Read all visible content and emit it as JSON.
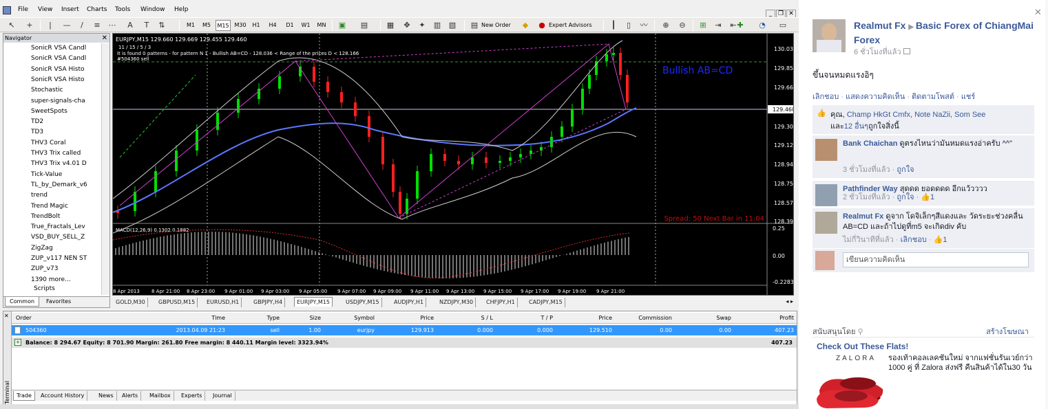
{
  "menubar": {
    "items": [
      "File",
      "View",
      "Insert",
      "Charts",
      "Tools",
      "Window",
      "Help"
    ]
  },
  "toolbar": {
    "periods": [
      "M1",
      "M5",
      "M15",
      "M30",
      "H1",
      "H4",
      "D1",
      "W1",
      "MN"
    ],
    "new_order": "New Order",
    "expert_advisors": "Expert Advisors"
  },
  "navigator": {
    "title": "Navigator",
    "items": [
      "SonicR VSA Candl",
      "SonicR VSA Candl",
      "SonicR VSA Histo",
      "SonicR VSA Histo",
      "Stochastic",
      "super-signals-cha",
      "SweetSpots",
      "TD2",
      "TD3",
      "THV3 Coral",
      "THV3 Trix called",
      "THV3 Trix v4.01 D",
      "Tick-Value",
      "TL_by_Demark_v6",
      "trend",
      "Trend Magic",
      "TrendBolt",
      "True_Fractals_Lev",
      "VSD_BUY_SELL_Z",
      "ZigZag",
      "ZUP_v117 NEN ST",
      "ZUP_v73",
      "1390 more..."
    ],
    "scripts": "Scripts",
    "tabs": [
      "Common",
      "Favorites"
    ]
  },
  "chart": {
    "header": "EURJPY,M15  129.660 129.669 129.455 129.460",
    "line2": "11 / 15 / 5 / 3",
    "line3": "It is found 0 patterns  -  for pattern N 1 - Bullish AB=CD - 128.036 < Range of the prices D < 128.166",
    "line4": "#504360 sell",
    "pattern_label": "Bullish AB=CD",
    "spread_text": "Spread: 50  Next Bar in 11:04",
    "price_labels": [
      "130.030",
      "129.850",
      "129.665",
      "129.460",
      "129.305",
      "129.120",
      "128.940",
      "128.755",
      "128.575",
      "128.395"
    ],
    "current_price": "129.460",
    "macd_label": "MACD(12,26,9) 0.1302 0.1882",
    "macd_levels": [
      "0.25",
      "0.00",
      "-0.2283"
    ],
    "time_labels": [
      "8 Apr 2013",
      "8 Apr 21:00",
      "8 Apr 23:00",
      "9 Apr 01:00",
      "9 Apr 03:00",
      "9 Apr 05:00",
      "9 Apr 07:00",
      "9 Apr 09:00",
      "9 Apr 11:00",
      "9 Apr 13:00",
      "9 Apr 15:00",
      "9 Apr 17:00",
      "9 Apr 19:00",
      "9 Apr 21:00"
    ]
  },
  "chart_tabs": [
    "GOLD,M30",
    "GBPUSD,M15",
    "EURUSD,H1",
    "GBPJPY,H4",
    "EURJPY,M15",
    "USDJPY,M15",
    "AUDJPY,H1",
    "NZDJPY,M30",
    "CHFJPY,H1",
    "CADJPY,M15"
  ],
  "terminal": {
    "side_label": "Terminal",
    "headers": [
      "Order",
      "Time",
      "Type",
      "Size",
      "Symbol",
      "Price",
      "S / L",
      "T / P",
      "Price",
      "Commission",
      "Swap",
      "Profit"
    ],
    "order_row": [
      "504360",
      "2013.04.09 21:23",
      "sell",
      "1.00",
      "eurjpy",
      "129.913",
      "0.000",
      "0.000",
      "129.510",
      "0.00",
      "0.00",
      "407.23"
    ],
    "balance_row": "Balance: 8 294.67  Equity: 8 701.90  Margin: 261.80  Free margin: 8 440.11  Margin level: 3323.94%",
    "balance_profit": "407.23",
    "tabs": [
      "Trade",
      "Account History",
      "News",
      "Alerts",
      "Mailbox",
      "Experts",
      "Journal"
    ]
  },
  "facebook": {
    "author": "Realmut Fx",
    "group": "Basic Forex of ChiangMai Forex",
    "time": "6 ชั่วโมงที่แล้ว",
    "post_text": "ขึ้นจนหมดแรงอิๆ",
    "actions": [
      "เลิกชอบ",
      "แสดงความคิดเห็น",
      "ติดตามโพสต์",
      "แชร์"
    ],
    "likes_prefix": "คุณ, ",
    "likes_names": "Champ HkGt Cmfx, Note NaZii, Som See",
    "likes_suffix": "และ",
    "likes_others": "12 อื่นๆ",
    "likes_end": "ถูกใจสิ่งนี้",
    "comments": [
      {
        "name": "Bank Chaichan",
        "text": "ดูตรงไหนว่ามันหมดแรงอ่าครับ ^^\"",
        "time": "3 ชั่วโมงที่แล้ว",
        "action": "ถูกใจ",
        "count": ""
      },
      {
        "name": "Pathfinder Way",
        "text": "สุดดด ยอดดดด อีกแว้วววว",
        "time": "2 ชั่วโมงที่แล้ว",
        "action": "ถูกใจ",
        "count": "1"
      },
      {
        "name": "Realmut Fx",
        "text": "ดูจาก โดจิเล็กๆสีแดงและ วัดระยะช่วงคลื่น AB=CD และถ้าไปดูที่m5 จะเกิดdiv คับ",
        "time": "ไม่กี่วินาทีที่แล้ว",
        "action": "เลิกชอบ",
        "count": "1"
      }
    ],
    "comment_placeholder": "เขียนความคิดเห็น",
    "sponsored": "สนับสนุนโดย",
    "create_ad": "สร้างโฆษณา",
    "ad_title": "Check Out These Flats!",
    "ad_brand": "ZALORA",
    "ad_text": "รองเท้าคอลเลคชันใหม่ จากแฟชั่นรันเวย์กว่า 1000 คู่ ที่ Zalora ส่งฟรี คืนสินค้าได้ใน30 วัน"
  }
}
